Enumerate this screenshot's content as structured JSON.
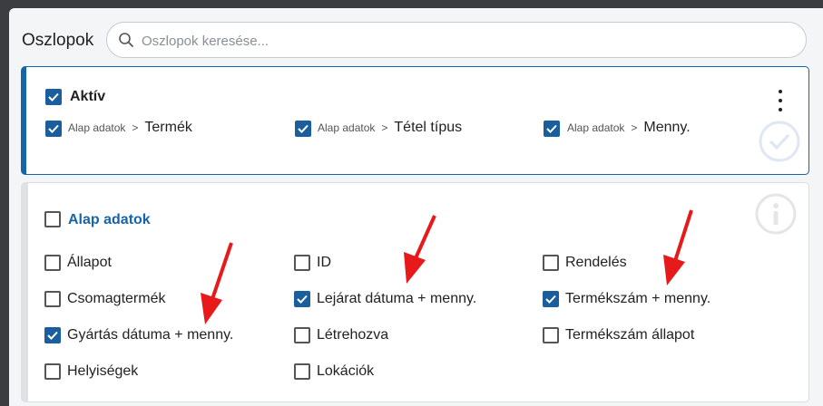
{
  "header": {
    "title": "Oszlopok",
    "search_placeholder": "Oszlopok keresése..."
  },
  "active_section": {
    "title": "Aktív",
    "checked": true,
    "items": [
      {
        "parent": "Alap adatok",
        "separator": ">",
        "label": "Termék",
        "checked": true
      },
      {
        "parent": "Alap adatok",
        "separator": ">",
        "label": "Tétel típus",
        "checked": true
      },
      {
        "parent": "Alap adatok",
        "separator": ">",
        "label": "Menny.",
        "checked": true
      }
    ]
  },
  "group_section": {
    "title": "Alap adatok",
    "checked": false,
    "items": [
      {
        "label": "Állapot",
        "checked": false
      },
      {
        "label": "ID",
        "checked": false
      },
      {
        "label": "Rendelés",
        "checked": false
      },
      {
        "label": "Csomagtermék",
        "checked": false
      },
      {
        "label": "Lejárat dátuma + menny.",
        "checked": true
      },
      {
        "label": "Termékszám + menny.",
        "checked": true
      },
      {
        "label": "Gyártás dátuma + menny.",
        "checked": true
      },
      {
        "label": "Létrehozva",
        "checked": false
      },
      {
        "label": "Termékszám állapot",
        "checked": false
      },
      {
        "label": "Helyiségek",
        "checked": false
      },
      {
        "label": "Lokációk",
        "checked": false
      }
    ]
  },
  "colors": {
    "accent": "#1b5e9e",
    "group_title": "#1565a8",
    "annotation_arrow": "#e8191b"
  },
  "icons": {
    "search": "search-icon",
    "menu": "kebab-menu-icon",
    "active_badge": "check-circle-icon",
    "group_badge": "info-circle-icon",
    "annotation": "red-arrow-icon"
  }
}
